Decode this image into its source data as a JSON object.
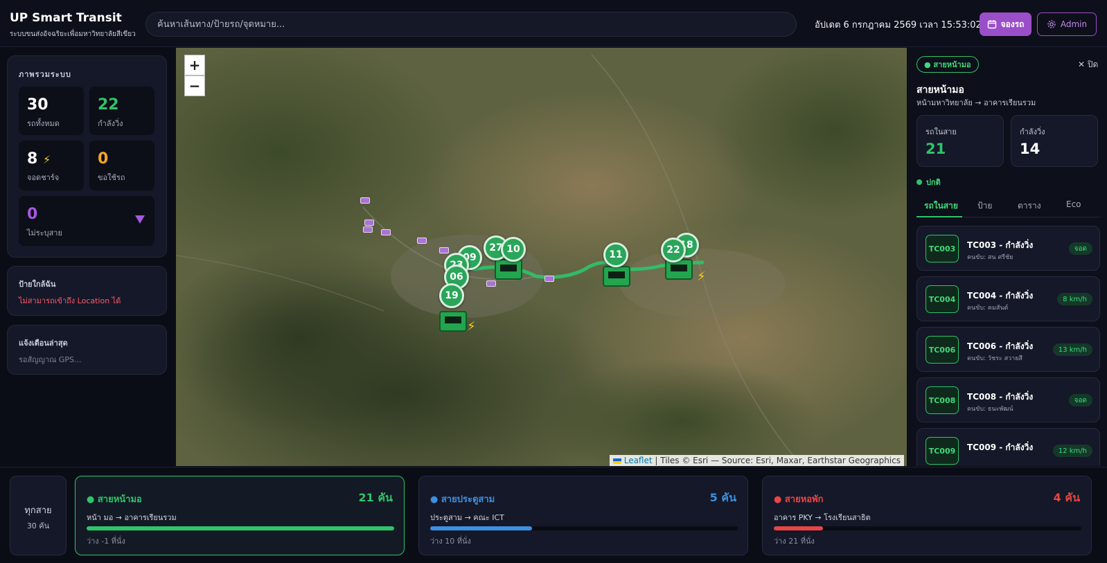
{
  "header": {
    "title": "UP Smart Transit",
    "subtitle": "ระบบขนส่งอัจฉริยะเพื่อมหาวิทยาลัยสีเขียว",
    "search_placeholder": "ค้นหาเส้นทาง/ป้ายรถ/จุดหมาย...",
    "clock": "อัปเดต 6 กรกฎาคม 2569 เวลา 15:53:02",
    "book_label": "จองรถ",
    "admin_label": "Admin",
    "accent": "#9a4fc9"
  },
  "overview": {
    "title": "ภาพรวมระบบ",
    "total": {
      "value": "30",
      "label": "รถทั้งหมด"
    },
    "running": {
      "value": "22",
      "label": "กำลังวิ่ง"
    },
    "charging": {
      "value": "8",
      "label": "จอดชาร์จ",
      "icon": "lightning-icon"
    },
    "requests": {
      "value": "0",
      "label": "ขอใช้รถ"
    },
    "unassigned": {
      "value": "0",
      "label": "ไม่ระบุสาย",
      "icon": "triangle-down-icon"
    }
  },
  "nearby": {
    "title": "ป้ายใกล้ฉัน",
    "message": "ไม่สามารถเข้าถึง Location ได้"
  },
  "alerts": {
    "title": "แจ้งเตือนล่าสุด",
    "message": "รอสัญญาณ GPS..."
  },
  "map": {
    "zoom_in": "+",
    "zoom_out": "−",
    "attribution_link": "Leaflet",
    "attribution_text": "| Tiles © Esri — Source: Esri, Maxar, Earthstar Geographics",
    "markers": [
      "09",
      "27",
      "10",
      "23",
      "06",
      "19",
      "11",
      "22",
      "18"
    ]
  },
  "route_panel": {
    "pill": "● สายหน้ามอ",
    "close_label": "✕ ปิด",
    "title": "สายหน้ามอ",
    "subtitle": "หน้ามหาวิทยาลัย → อาคารเรียนรวม",
    "in_route": {
      "label": "รถในสาย",
      "value": "21"
    },
    "running": {
      "label": "กำลังวิ่ง",
      "value": "14"
    },
    "status": "ปกติ",
    "tabs": [
      "รถในสาย",
      "ป้าย",
      "ตาราง",
      "Eco"
    ],
    "vehicles": [
      {
        "code": "TC003",
        "title": "TC003 - กำลังวิ่ง",
        "driver": "คนขับ: สน ศรีชัย",
        "badge": "จอด"
      },
      {
        "code": "TC004",
        "title": "TC004 - กำลังวิ่ง",
        "driver": "คนขับ: คมสันต์",
        "badge": "8 km/h"
      },
      {
        "code": "TC006",
        "title": "TC006 - กำลังวิ่ง",
        "driver": "คนขับ: วัชระ สวายสี",
        "badge": "13 km/h"
      },
      {
        "code": "TC008",
        "title": "TC008 - กำลังวิ่ง",
        "driver": "คนขับ: ธนะพัฒน์",
        "badge": "จอด"
      },
      {
        "code": "TC009",
        "title": "TC009 - กำลังวิ่ง",
        "driver": "",
        "badge": "12 km/h"
      }
    ]
  },
  "routes_bar": {
    "all": {
      "title": "ทุกสาย",
      "count": "30 คัน"
    },
    "routes": [
      {
        "name": "● สายหน้ามอ",
        "count": "21 คัน",
        "path": "หน้า มอ → อาคารเรียนรวม",
        "seats": "ว่าง -1 ที่นั่ง",
        "color": "#2ec46a",
        "fill": 1.0
      },
      {
        "name": "● สายประตูสาม",
        "count": "5 คัน",
        "path": "ประตูสาม → คณะ ICT",
        "seats": "ว่าง 10 ที่นั่ง",
        "color": "#3d8fe0",
        "fill": 0.33
      },
      {
        "name": "● สายหอพัก",
        "count": "4 คัน",
        "path": "อาคาร PKY → โรงเรียนสาธิต",
        "seats": "ว่าง 21 ที่นั่ง",
        "color": "#e84545",
        "fill": 0.16
      }
    ]
  }
}
